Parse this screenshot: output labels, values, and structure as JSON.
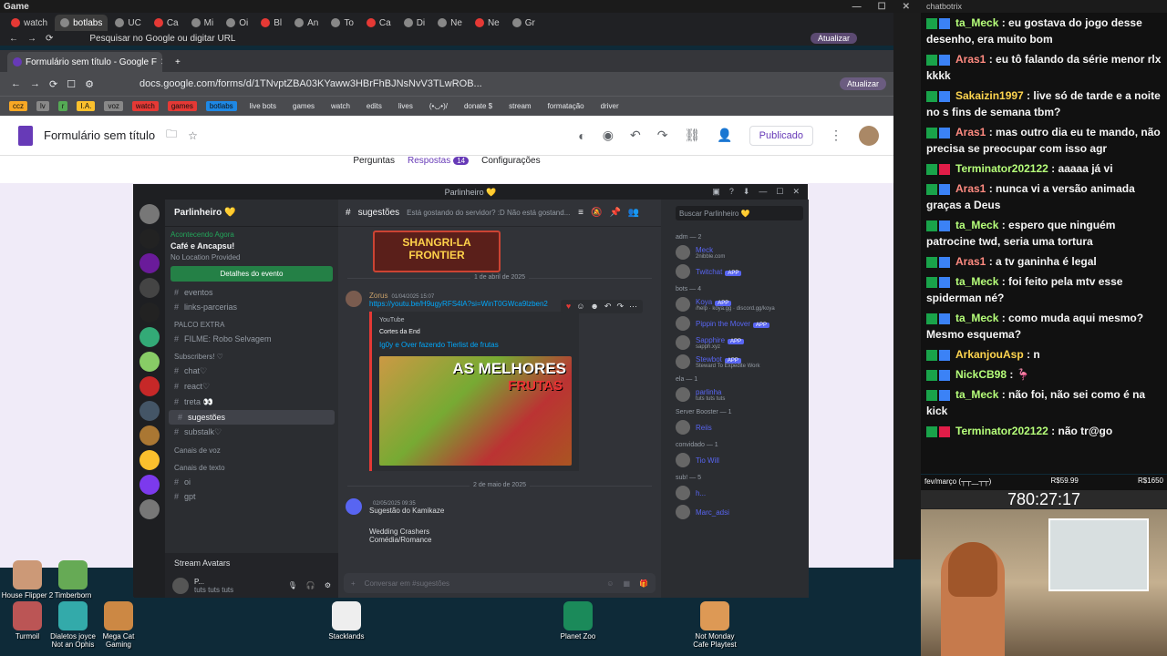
{
  "obs": {
    "title": "Game"
  },
  "browser1": {
    "tabs": [
      {
        "label": "watch",
        "active": false
      },
      {
        "label": "botlabs",
        "active": true
      },
      {
        "label": "UC",
        "active": false
      },
      {
        "label": "Ca",
        "active": false
      },
      {
        "label": "Mi",
        "active": false
      },
      {
        "label": "Oi",
        "active": false
      },
      {
        "label": "Bl",
        "active": false
      },
      {
        "label": "An",
        "active": false
      },
      {
        "label": "To",
        "active": false
      },
      {
        "label": "Ca",
        "active": false
      },
      {
        "label": "Di",
        "active": false
      },
      {
        "label": "Ne",
        "active": false
      },
      {
        "label": "Ne",
        "active": false
      },
      {
        "label": "Gr",
        "active": false
      }
    ],
    "url": "Pesquisar no Google ou digitar URL",
    "update_label": "Atualizar"
  },
  "browser2": {
    "tab_title": "Formulário sem título - Google F",
    "url": "docs.google.com/forms/d/1TNvptZBA03KYaww3HBrFhBJNsNvV3TLwROB...",
    "update_label": "Atualizar",
    "bookmarks": [
      "ccz",
      "lv",
      "r",
      "I.A.",
      "voz",
      "watch",
      "games",
      "botlabs",
      "live bots",
      "games",
      "watch",
      "edits",
      "lives",
      "(•◡•)/",
      "donate $",
      "stream",
      "formatação",
      "driver"
    ]
  },
  "forms": {
    "title": "Formulário sem título",
    "publish_label": "Publicado",
    "tabs": [
      {
        "label": "Perguntas"
      },
      {
        "label": "Respostas"
      },
      {
        "label": "Configurações"
      }
    ],
    "responses_count": "14"
  },
  "discord": {
    "window_title": "Parlinheiro 💛",
    "server_name": "Parlinheiro 💛",
    "event": {
      "status": "Acontecendo Agora",
      "name": "Café e Ancapsu!",
      "location": "No Location Provided",
      "button": "Detalhes do evento"
    },
    "channels": [
      {
        "label": "eventos",
        "type": "channel",
        "selected": false
      },
      {
        "label": "links-parcerias",
        "type": "channel",
        "selected": false
      },
      {
        "label": "PALCO EXTRA",
        "type": "category",
        "selected": false
      },
      {
        "label": "FILME: Robo Selvagem",
        "type": "channel",
        "selected": false
      },
      {
        "label": "Subscribers! ♡",
        "type": "category",
        "selected": false
      },
      {
        "label": "chat♡",
        "type": "channel",
        "selected": false
      },
      {
        "label": "react♡",
        "type": "channel",
        "selected": false
      },
      {
        "label": "treta 👀",
        "type": "channel",
        "selected": false
      },
      {
        "label": "sugestões",
        "type": "channel",
        "selected": true
      },
      {
        "label": "substalk♡",
        "type": "channel",
        "selected": false
      },
      {
        "label": "Canais de voz",
        "type": "category",
        "selected": false
      },
      {
        "label": "Canais de texto",
        "type": "category",
        "selected": false
      },
      {
        "label": "oi",
        "type": "channel",
        "selected": false
      },
      {
        "label": "gpt",
        "type": "channel",
        "selected": false
      }
    ],
    "stream_avatars": "Stream Avatars",
    "user": {
      "name": "P...",
      "status": "tuts tuts tuts"
    },
    "channel_header": "sugestões",
    "topic": "Está gostando do servidor? :D Não está gostand...",
    "search_placeholder": "Buscar Parlinheiro 💛",
    "top_image_text": "SHANGRI-LA FRONTIER",
    "divider1": "1 de abril de 2025",
    "message": {
      "author": "Zorus",
      "time": "01/04/2025 15:07",
      "link": "https://youtu.be/H9ugyRFS4lA?si=WinT0GWca9lzben2",
      "provider": "YouTube",
      "channel": "Cortes da End",
      "video_title": "Ig0y e Over fazendo Tierlist de frutas",
      "thumb_line1": "AS MELHORES",
      "thumb_line2": "FRUTAS"
    },
    "divider2": "2 de maio de 2025",
    "message2": {
      "time": "02/05/2025 09:35",
      "title": "Sugestão do Kamikaze",
      "line1": "Wedding Crashers",
      "line2": "Comédia/Romance"
    },
    "composer_placeholder": "Conversar em #sugestões",
    "members": [
      {
        "group": "adm — 2"
      },
      {
        "name": "Meck",
        "sub": "2nibble.com"
      },
      {
        "name": "Twitchat",
        "sub": "",
        "app": "APP"
      },
      {
        "group": "bots — 4"
      },
      {
        "name": "Koya",
        "sub": "/help · koya.gg · discord.gg/koya",
        "app": "APP"
      },
      {
        "name": "Pippin the Mover",
        "sub": "",
        "app": "APP"
      },
      {
        "name": "Sapphire",
        "sub": "sapph.xyz",
        "app": "APP"
      },
      {
        "name": "Stewbot",
        "sub": "Steward To Expedite Work",
        "app": "APP"
      },
      {
        "group": "ela — 1"
      },
      {
        "name": "parlinha",
        "sub": "tuts tuts tuts"
      },
      {
        "group": "Server Booster — 1"
      },
      {
        "name": "Reiis",
        "sub": ""
      },
      {
        "group": "convidado — 1"
      },
      {
        "name": "Tio Will",
        "sub": ""
      },
      {
        "group": "sub! — 5"
      },
      {
        "name": "h...",
        "sub": ""
      },
      {
        "name": "Marc_adsi",
        "sub": ""
      }
    ]
  },
  "chat": {
    "title": "chatbotrix",
    "messages": [
      {
        "user": "ta_Meck",
        "text": "eu gostava do jogo desse desenho, era muito bom",
        "color": "#b6ff7a"
      },
      {
        "user": "Aras1",
        "text": "eu tô falando da série menor rlx kkkk",
        "color": "#ff8a80"
      },
      {
        "user": "Sakaizin1997",
        "text": "live só de tarde e a noite no s fins de semana tbm?",
        "color": "#ffd54f"
      },
      {
        "user": "Aras1",
        "text": "mas outro dia eu te mando, não precisa se preocupar com isso agr",
        "color": "#ff8a80"
      },
      {
        "user": "Terminator202122",
        "text": "aaaaa já vi",
        "color": "#b6ff7a"
      },
      {
        "user": "Aras1",
        "text": "nunca vi a versão animada graças a Deus",
        "color": "#ff8a80"
      },
      {
        "user": "ta_Meck",
        "text": "espero que ninguém patrocine twd, seria uma tortura",
        "color": "#b6ff7a"
      },
      {
        "user": "Aras1",
        "text": "a tv ganinha é legal",
        "color": "#ff8a80"
      },
      {
        "user": "ta_Meck",
        "text": "foi feito pela mtv esse spiderman né?",
        "color": "#b6ff7a"
      },
      {
        "user": "ta_Meck",
        "text": "como muda aqui mesmo? Mesmo esquema?",
        "color": "#b6ff7a"
      },
      {
        "user": "ArkanjouAsp",
        "text": "n",
        "color": "#ffd54f"
      },
      {
        "user": "NickCB98",
        "text": "🦩",
        "color": "#b6ff7a"
      },
      {
        "user": "ta_Meck",
        "text": "não foi, não sei como é na kick",
        "color": "#b6ff7a"
      },
      {
        "user": "Terminator202122",
        "text": "não tr@go",
        "color": "#b6ff7a"
      }
    ]
  },
  "webcam": {
    "left": "fev/março (┬┬﹏┬┬)",
    "goal1": "R$59.99",
    "goal2": "R$1650",
    "timer": "780:27:17"
  },
  "desktop": {
    "icons": [
      "House Flipper 2",
      "Timberborn",
      "Turmoil",
      "Dialetos joyce Not an Ophis",
      "Mega Cat Gaming",
      "Stacklands",
      "Planet Zoo",
      "Not Monday Cafe Playtest"
    ]
  }
}
